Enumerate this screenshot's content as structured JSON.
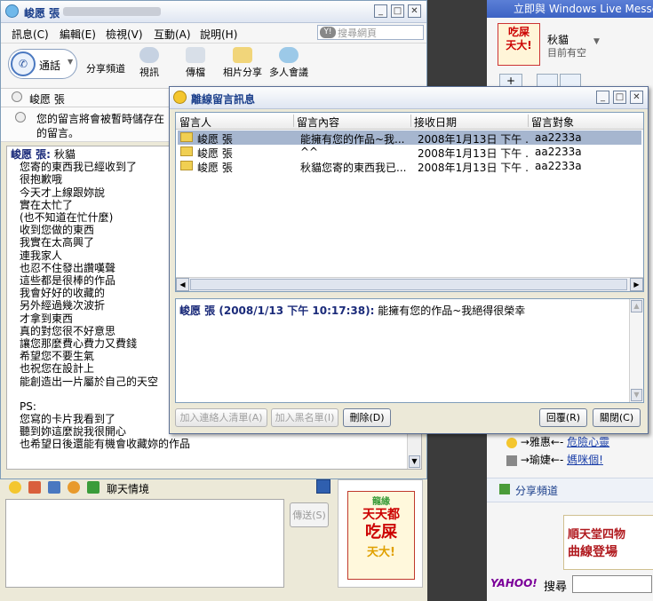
{
  "background": {
    "right_header": "立即與 Windows Live Messenger",
    "profile_name": "秋貓",
    "profile_status": "目前有空",
    "promo_lines": [
      {
        "arrow": "→雅惠←-",
        "link": "危險心靈"
      },
      {
        "arrow": "→瑜婕←-",
        "link": "媽咪個!"
      }
    ],
    "share_channel": "分享頻道",
    "ad_text_1": "順天堂四物",
    "ad_text_2": "曲線登場",
    "yahoo_logo": "YAHOO!",
    "yahoo_search_label": "搜尋",
    "logo_text": [
      "天天都",
      "吃屎",
      "天大!"
    ],
    "logo_top_label": "龍緣"
  },
  "main": {
    "title": "峻愿 張",
    "menu": [
      "訊息(C)",
      "編輯(E)",
      "檢視(V)",
      "互動(A)",
      "說明(H)"
    ],
    "search_placeholder": "搜尋網頁",
    "call_label": "通話",
    "tools": [
      "分享頻道",
      "視訊",
      "傳檔",
      "相片分享",
      "多人會議"
    ],
    "contact_name": "峻愿 張",
    "info_text_1": "您的留言將會被暫時儲存在",
    "info_text_2": "的留言。",
    "chat_sender": "峻愿 張:",
    "chat_first": "秋貓",
    "chat_lines": [
      "您寄的東西我已經收到了",
      "很抱歉哦",
      "今天才上線跟妳說",
      "實在太忙了",
      "(也不知道在忙什麼)",
      "收到您做的東西",
      "我實在太高興了",
      "連我家人",
      "也忍不住發出讚嘆聲",
      "這些都是很棒的作品",
      "我會好好的收藏的",
      "另外經過幾次波折",
      "才拿到東西",
      "真的對您很不好意思",
      "讓您那麼費心費力又費錢",
      "希望您不要生氣",
      "也祝您在設計上",
      "能創造出一片屬於自己的天空",
      "",
      "PS:",
      "您寫的卡片我看到了",
      "聽到妳這麼說我很開心",
      "也希望日後還能有機會收藏妳的作品"
    ],
    "mood_label": "聊天情境",
    "send_label": "傳送(S)"
  },
  "dialog": {
    "title": "離線留言訊息",
    "columns": [
      "留言人",
      "留言內容",
      "接收日期",
      "留言對象"
    ],
    "rows": [
      {
        "sender": "峻愿 張",
        "content": "能擁有您的作品~我...",
        "date": "2008年1月13日 下午 ...",
        "target": "aa2233a",
        "selected": true
      },
      {
        "sender": "峻愿 張",
        "content": "^^",
        "date": "2008年1月13日 下午 ...",
        "target": "aa2233a",
        "selected": false
      },
      {
        "sender": "峻愿 張",
        "content": "秋貓您寄的東西我已...",
        "date": "2008年1月13日 下午 ...",
        "target": "aa2233a",
        "selected": false
      }
    ],
    "detail_sender": "峻愿 張 (2008/1/13 下午 10:17:38):",
    "detail_message": "能擁有您的作品~我絕得很榮幸",
    "buttons": {
      "add_contact": "加入連絡人清單(A)",
      "add_block": "加入黑名單(I)",
      "delete": "刪除(D)",
      "reply": "回覆(R)",
      "close": "關閉(C)"
    }
  },
  "colors": {
    "title_text": "#1b3f8b",
    "selection": "#a6b6cf",
    "sender_text": "#1b2b7a",
    "window_bg": "#ece9d8"
  }
}
